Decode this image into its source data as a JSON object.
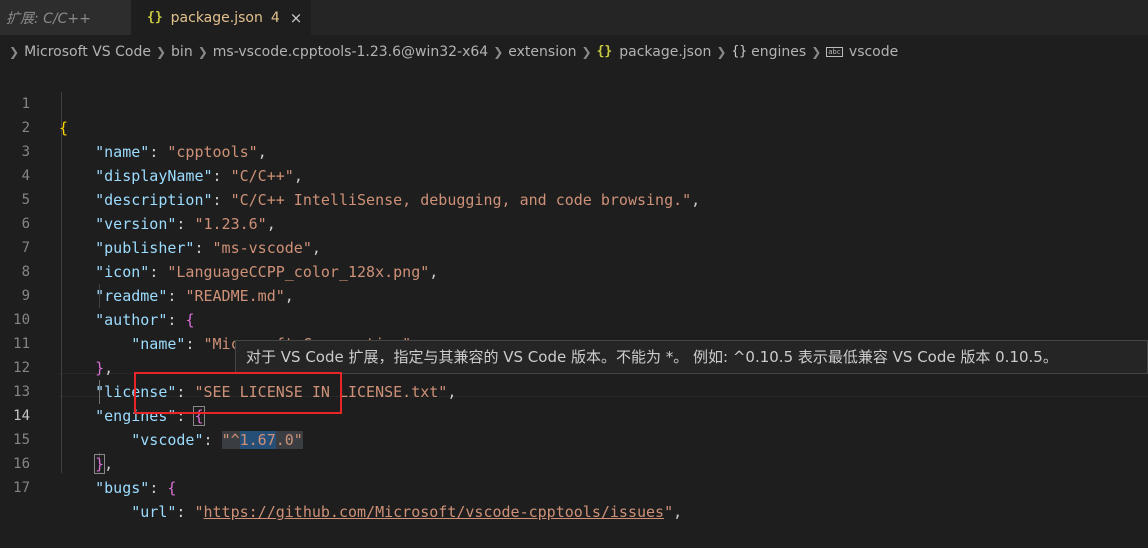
{
  "tabs": [
    {
      "label": "扩展: C/C++"
    },
    {
      "icon": "json-braces-icon",
      "label": "package.json",
      "badge": "4",
      "close": "×"
    }
  ],
  "breadcrumb": {
    "items": [
      "Microsoft VS Code",
      "bin",
      "ms-vscode.cpptools-1.23.6@win32-x64",
      "extension",
      "package.json",
      "engines",
      "vscode"
    ],
    "json_icon": "{}",
    "object_icon": "{}",
    "string_icon": "abc"
  },
  "editor": {
    "line_numbers": [
      "1",
      "2",
      "3",
      "4",
      "5",
      "6",
      "7",
      "8",
      "9",
      "10",
      "11",
      "12",
      "13",
      "14",
      "15",
      "16",
      "17"
    ],
    "active_line": "14",
    "lines": {
      "l1_brace": "{",
      "l2_key": "\"name\"",
      "l2_val": "\"cpptools\"",
      "l3_key": "\"displayName\"",
      "l3_val": "\"C/C++\"",
      "l4_key": "\"description\"",
      "l4_val": "\"C/C++ IntelliSense, debugging, and code browsing.\"",
      "l5_key": "\"version\"",
      "l5_val": "\"1.23.6\"",
      "l6_key": "\"publisher\"",
      "l6_val": "\"ms-vscode\"",
      "l7_key": "\"icon\"",
      "l7_val": "\"LanguageCCPP_color_128x.png\"",
      "l8_key": "\"readme\"",
      "l8_val": "\"README.md\"",
      "l9_key": "\"author\"",
      "l9_brace": "{",
      "l10_key": "\"name\"",
      "l10_val": "\"Microsoft Corporation\"",
      "l11_brace": "}",
      "l12_key": "\"license\"",
      "l12_val": "\"SEE LICENSE IN LICENSE.txt\"",
      "l13_key": "\"engines\"",
      "l13_brace": "{",
      "l14_key": "\"vscode\"",
      "l14_val_a": "\"^",
      "l14_val_b": "1.67",
      "l14_val_c": ".0\"",
      "l15_brace": "}",
      "l16_key": "\"bugs\"",
      "l16_brace": "{",
      "l17_key": "\"url\"",
      "l17_val": "https://github.com/Microsoft/vscode-cpptools/issues"
    },
    "hover_text": "对于 VS Code 扩展，指定与其兼容的 VS Code 版本。不能为 *。 例如: ^0.10.5 表示最低兼容 VS Code 版本 0.10.5。"
  },
  "colors": {
    "background": "#1e1e1e",
    "json_key": "#9cdcfe",
    "json_string": "#ce9178",
    "annotation_box": "#e8262a"
  }
}
